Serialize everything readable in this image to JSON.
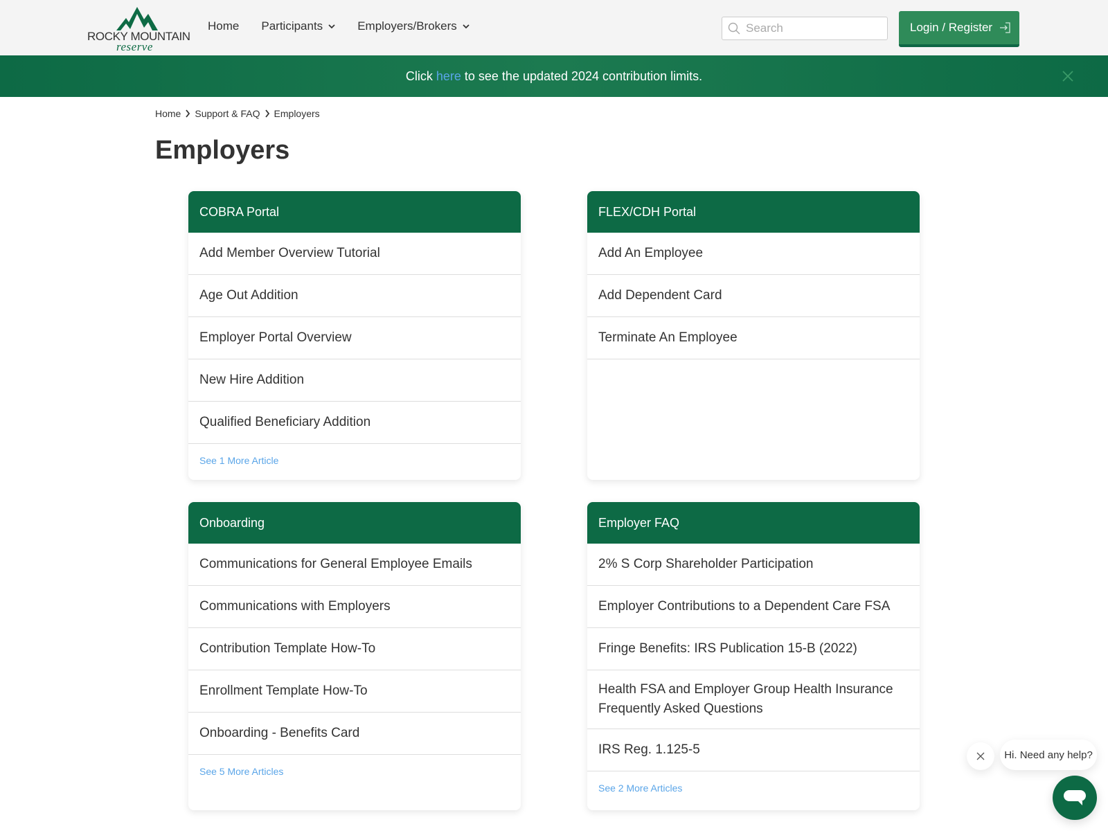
{
  "brand": {
    "name_top": "ROCKY MOUNTAIN",
    "name_bottom": "reserve",
    "primary_color": "#0d6a45",
    "button_color": "#2f8b59",
    "link_color": "#5aa5e8"
  },
  "nav": {
    "items": [
      {
        "label": "Home",
        "has_dropdown": false
      },
      {
        "label": "Participants",
        "has_dropdown": true
      },
      {
        "label": "Employers/Brokers",
        "has_dropdown": true
      }
    ]
  },
  "search": {
    "placeholder": "Search",
    "value": ""
  },
  "login": {
    "label": "Login / Register",
    "icon": "sign-in-icon"
  },
  "banner": {
    "prefix": "Click",
    "link_text": "here",
    "suffix": "to see the updated 2024 contribution limits.",
    "close_icon": "close-icon"
  },
  "breadcrumb": {
    "items": [
      "Home",
      "Support & FAQ",
      "Employers"
    ]
  },
  "page": {
    "title": "Employers"
  },
  "sections": [
    {
      "title": "COBRA Portal",
      "articles": [
        "Add Member Overview Tutorial",
        "Age Out Addition",
        "Employer Portal Overview",
        "New Hire Addition",
        "Qualified Beneficiary Addition"
      ],
      "more_label": "See 1 More Article"
    },
    {
      "title": "FLEX/CDH Portal",
      "articles": [
        "Add An Employee",
        "Add Dependent Card",
        "Terminate An Employee"
      ],
      "more_label": ""
    },
    {
      "title": "Onboarding",
      "articles": [
        "Communications for General Employee Emails",
        "Communications with Employers",
        "Contribution Template How-To",
        "Enrollment Template How-To",
        "Onboarding - Benefits Card"
      ],
      "more_label": "See 5 More Articles"
    },
    {
      "title": "Employer FAQ",
      "articles": [
        "2% S Corp Shareholder Participation",
        "Employer Contributions to a Dependent Care FSA",
        "Fringe Benefits: IRS Publication 15-B (2022)",
        "Health FSA and Employer Group Health Insurance Frequently Asked Questions",
        "IRS Reg. 1.125-5"
      ],
      "more_label": "See 2 More Articles"
    }
  ],
  "chat": {
    "greeting": "Hi. Need any help?",
    "close_icon": "close-icon",
    "launcher_icon": "chat-icon"
  }
}
